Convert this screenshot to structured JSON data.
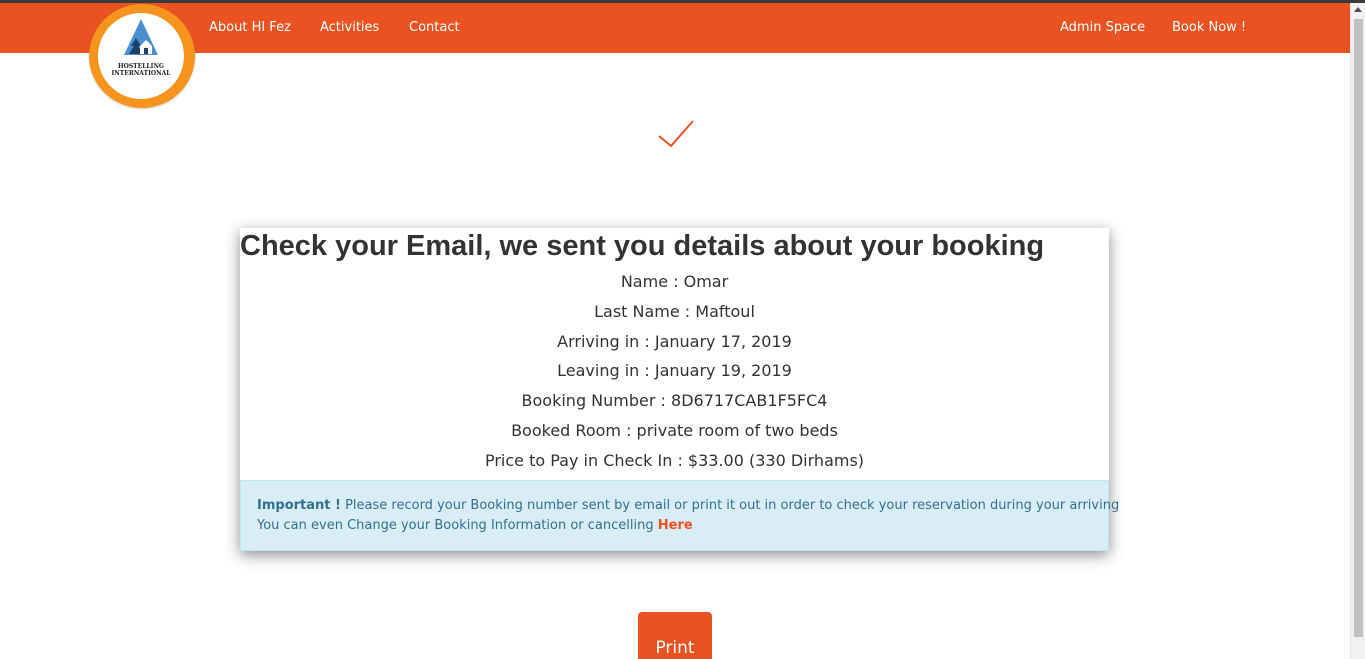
{
  "nav": {
    "left_links": [
      {
        "label": "About HI Fez"
      },
      {
        "label": "Activities"
      },
      {
        "label": "Contact"
      }
    ],
    "right_links": [
      {
        "label": "Admin Space"
      },
      {
        "label": "Book Now !"
      }
    ],
    "brand_color": "#ea5321"
  },
  "logo": {
    "line1": "HOSTELLING",
    "line2": "INTERNATIONAL",
    "icon": "hostel-house-tree-icon"
  },
  "confirmation": {
    "icon": "checkmark-icon",
    "title": "Check your Email, we sent you details about your booking",
    "details": [
      "Name : Omar",
      "Last Name : Maftoul",
      "Arriving in : January 17, 2019",
      "Leaving in : January 19, 2019",
      "Booking Number : 8D6717CAB1F5FC4",
      "Booked Room : private room of two beds",
      "Price to Pay in Check In : $33.00 (330 Dirhams)"
    ]
  },
  "alert": {
    "strong": "Important !",
    "line1": " Please record your Booking number sent by email or print it out in order to check your reservation during your arriving",
    "line2": "You can even Change your Booking Information or cancelling ",
    "link": "Here"
  },
  "print_button": "Print"
}
